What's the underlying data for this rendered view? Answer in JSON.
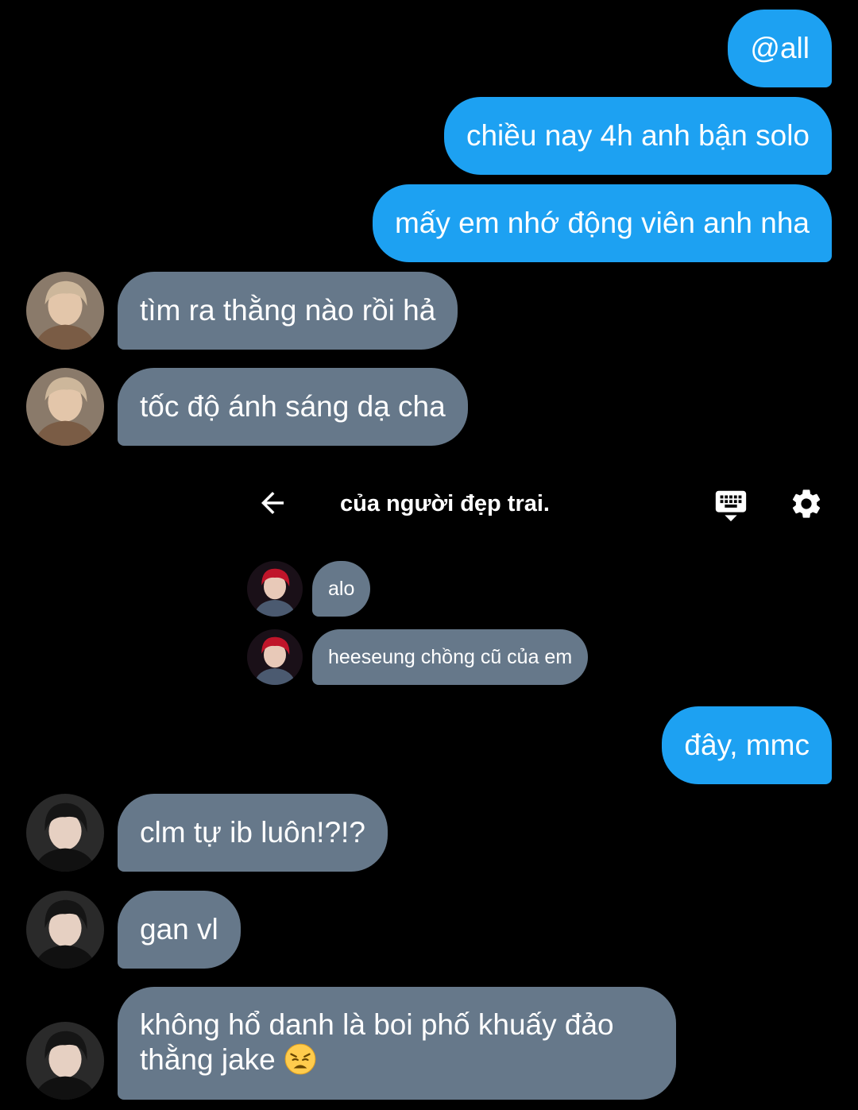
{
  "top_messages": [
    {
      "dir": "out",
      "text": "@all"
    },
    {
      "dir": "out",
      "text": "chiều nay 4h anh bận solo"
    },
    {
      "dir": "out",
      "text": "mấy em nhớ động viên anh nha"
    },
    {
      "dir": "in",
      "avatar": "light-hair-avatar",
      "text": "tìm ra thằng nào rồi hả"
    },
    {
      "dir": "in",
      "avatar": "light-hair-avatar",
      "text": "tốc độ ánh sáng dạ cha"
    }
  ],
  "embedded_chat": {
    "title": "của người đẹp trai.",
    "back_icon": "arrow-left-icon",
    "keyboard_icon": "keyboard-hide-icon",
    "settings_icon": "gear-icon",
    "messages": [
      {
        "text": "alo",
        "avatar": "red-hair-avatar"
      },
      {
        "text": "heeseung chồng cũ của em",
        "avatar": "red-hair-avatar"
      }
    ]
  },
  "bottom_messages": [
    {
      "dir": "out",
      "text": "đây, mmc"
    },
    {
      "dir": "in",
      "avatar": "dark-hair-avatar",
      "text": "clm tự ib luôn!?!?"
    },
    {
      "dir": "in",
      "avatar": "dark-hair-avatar",
      "text": "gan vl"
    },
    {
      "dir": "in",
      "avatar": "dark-hair-avatar",
      "text_line1": "không hổ danh là boi phố khuấy đảo",
      "text_line2": "thằng jake",
      "emoji": "weary-face-emoji"
    }
  ],
  "colors": {
    "outgoing": "#1da1f2",
    "incoming": "#66788a",
    "background": "#000000"
  }
}
